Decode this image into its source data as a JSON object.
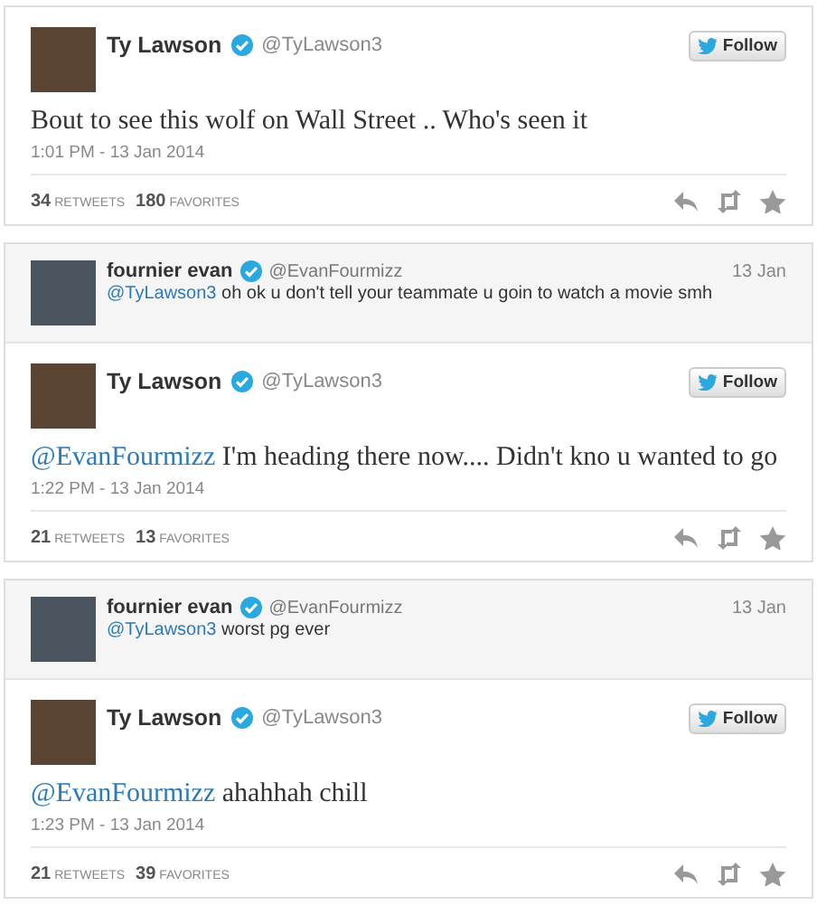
{
  "tweets": [
    {
      "author": {
        "name": "Ty Lawson",
        "handle": "@TyLawson3",
        "verified": true
      },
      "follow_label": "Follow",
      "text": "Bout to see this wolf on Wall Street .. Who's seen it",
      "timestamp": "1:01 PM - 13 Jan 2014",
      "stats": [
        {
          "count": "34",
          "label": "RETWEETS"
        },
        {
          "count": "180",
          "label": "FAVORITES"
        }
      ]
    },
    {
      "reply_to": {
        "name": "fournier evan",
        "handle": "@EvanFourmizz",
        "verified": true,
        "date": "13 Jan",
        "mention": "@TyLawson3",
        "text": "oh ok u don't tell your teammate u goin to watch a movie smh"
      },
      "author": {
        "name": "Ty Lawson",
        "handle": "@TyLawson3",
        "verified": true
      },
      "follow_label": "Follow",
      "mention": "@EvanFourmizz",
      "text": "I'm heading there now.... Didn't kno u wanted to go",
      "timestamp": "1:22 PM - 13 Jan 2014",
      "stats": [
        {
          "count": "21",
          "label": "RETWEETS"
        },
        {
          "count": "13",
          "label": "FAVORITES"
        }
      ]
    },
    {
      "reply_to": {
        "name": "fournier evan",
        "handle": "@EvanFourmizz",
        "verified": true,
        "date": "13 Jan",
        "mention": "@TyLawson3",
        "text": "worst pg ever"
      },
      "author": {
        "name": "Ty Lawson",
        "handle": "@TyLawson3",
        "verified": true
      },
      "follow_label": "Follow",
      "mention": "@EvanFourmizz",
      "text": "ahahhah chill",
      "timestamp": "1:23 PM - 13 Jan 2014",
      "stats": [
        {
          "count": "21",
          "label": "RETWEETS"
        },
        {
          "count": "39",
          "label": "FAVORITES"
        }
      ]
    }
  ]
}
